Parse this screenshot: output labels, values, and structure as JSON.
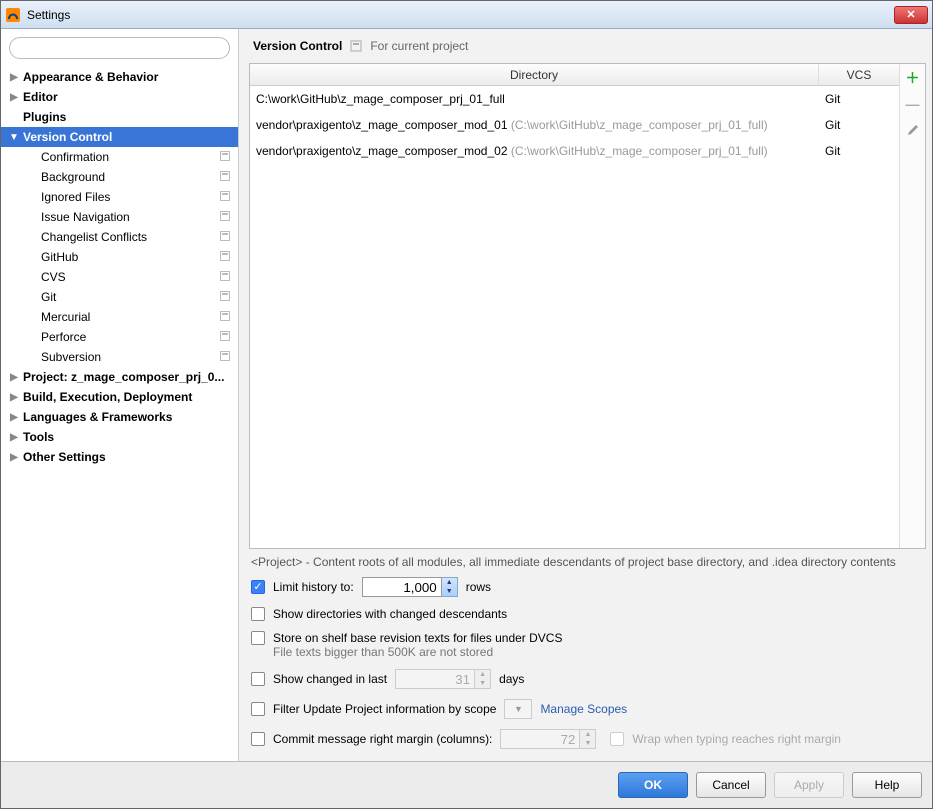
{
  "window": {
    "title": "Settings"
  },
  "breadcrumb": {
    "title": "Version Control",
    "scope": "For current project"
  },
  "sidebar": {
    "search_placeholder": "",
    "top": [
      {
        "label": "Appearance & Behavior"
      },
      {
        "label": "Editor"
      },
      {
        "label": "Plugins",
        "leaf": true
      },
      {
        "label": "Version Control",
        "selected": true,
        "expanded": true
      }
    ],
    "vc_children": [
      {
        "label": "Confirmation"
      },
      {
        "label": "Background"
      },
      {
        "label": "Ignored Files"
      },
      {
        "label": "Issue Navigation"
      },
      {
        "label": "Changelist Conflicts"
      },
      {
        "label": "GitHub"
      },
      {
        "label": "CVS"
      },
      {
        "label": "Git"
      },
      {
        "label": "Mercurial"
      },
      {
        "label": "Perforce"
      },
      {
        "label": "Subversion"
      }
    ],
    "bottom": [
      {
        "label": "Project: z_mage_composer_prj_0..."
      },
      {
        "label": "Build, Execution, Deployment"
      },
      {
        "label": "Languages & Frameworks"
      },
      {
        "label": "Tools"
      },
      {
        "label": "Other Settings"
      }
    ]
  },
  "table": {
    "col_dir": "Directory",
    "col_vcs": "VCS",
    "rows": [
      {
        "path": "C:\\work\\GitHub\\z_mage_composer_prj_01_full",
        "sub": "",
        "vcs": "Git"
      },
      {
        "path": "vendor\\praxigento\\z_mage_composer_mod_01",
        "sub": " (C:\\work\\GitHub\\z_mage_composer_prj_01_full)",
        "vcs": "Git"
      },
      {
        "path": "vendor\\praxigento\\z_mage_composer_mod_02",
        "sub": " (C:\\work\\GitHub\\z_mage_composer_prj_01_full)",
        "vcs": "Git"
      }
    ]
  },
  "note": "<Project> - Content roots of all modules, all immediate descendants of project base directory, and .idea directory contents",
  "options": {
    "limit_history": {
      "checked": true,
      "label_pre": "Limit history to:",
      "value": "1,000",
      "label_post": "rows"
    },
    "show_dirs": {
      "checked": false,
      "label": "Show directories with changed descendants"
    },
    "store_shelf": {
      "checked": false,
      "label": "Store on shelf base revision texts for files under DVCS",
      "sub": "File texts bigger than 500K are not stored"
    },
    "show_changed": {
      "checked": false,
      "label_pre": "Show changed in last",
      "value": "31",
      "label_post": "days"
    },
    "filter_scope": {
      "checked": false,
      "label": "Filter Update Project information by scope",
      "link": "Manage Scopes"
    },
    "commit_margin": {
      "checked": false,
      "label": "Commit message right margin (columns):",
      "value": "72",
      "wrap_label": "Wrap when typing reaches right margin"
    }
  },
  "buttons": {
    "ok": "OK",
    "cancel": "Cancel",
    "apply": "Apply",
    "help": "Help"
  }
}
